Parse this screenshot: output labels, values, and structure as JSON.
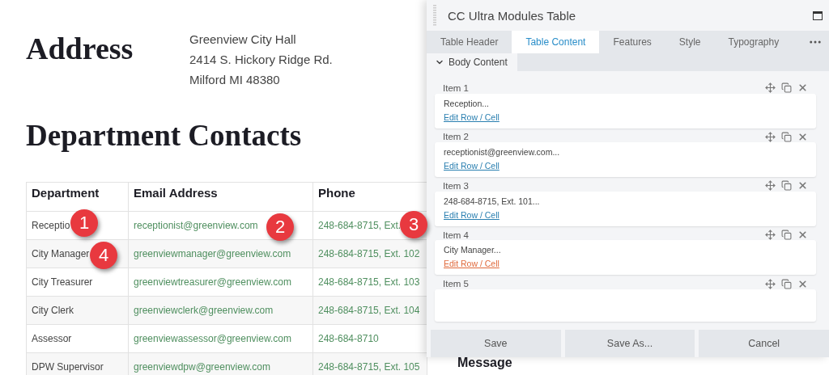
{
  "page": {
    "address_heading": "Address",
    "address_lines": [
      "Greenview City Hall",
      "2414 S. Hickory Ridge Rd.",
      "Milford MI 48380"
    ],
    "contacts_heading": "Department Contacts",
    "table": {
      "columns": [
        "Department",
        "Email Address",
        "Phone"
      ],
      "rows": [
        {
          "department": "Receptio",
          "email": "receptionist@greenview.com",
          "phone": "248-684-8715, Ext."
        },
        {
          "department": "City Manager",
          "email": "greenviewmanager@greenview.com",
          "phone": "248-684-8715, Ext. 102"
        },
        {
          "department": "City Treasurer",
          "email": "greenviewtreasurer@greenview.com",
          "phone": "248-684-8715, Ext. 103"
        },
        {
          "department": "City Clerk",
          "email": "greenviewclerk@greenview.com",
          "phone": "248-684-8715, Ext. 104"
        },
        {
          "department": "Assessor",
          "email": "greenviewassessor@greenview.com",
          "phone": "248-684-8710"
        },
        {
          "department": "DPW Supervisor",
          "email": "greenviewdpw@greenview.com",
          "phone": "248-684-8715, Ext. 105"
        }
      ]
    },
    "message_heading": "Message"
  },
  "callouts": [
    "1",
    "2",
    "3",
    "4"
  ],
  "panel": {
    "title": "CC Ultra Modules Table",
    "tabs": [
      {
        "label": "Table Header",
        "selected": false
      },
      {
        "label": "Table Content",
        "selected": true
      },
      {
        "label": "Features",
        "selected": false
      },
      {
        "label": "Style",
        "selected": false
      },
      {
        "label": "Typography",
        "selected": false
      }
    ],
    "section": {
      "label": "Body Content",
      "expanded": true
    },
    "items": [
      {
        "label": "Item 1",
        "text": "Reception...",
        "link": "Edit Row / Cell",
        "hovered": false
      },
      {
        "label": "Item 2",
        "text": "receptionist@greenview.com...",
        "link": "Edit Row / Cell",
        "hovered": false
      },
      {
        "label": "Item 3",
        "text": "248-684-8715, Ext. 101...",
        "link": "Edit Row / Cell",
        "hovered": false
      },
      {
        "label": "Item 4",
        "text": "City Manager...",
        "link": "Edit Row / Cell",
        "hovered": true
      },
      {
        "label": "Item 5"
      }
    ],
    "buttons": [
      "Save",
      "Save As...",
      "Cancel"
    ]
  }
}
